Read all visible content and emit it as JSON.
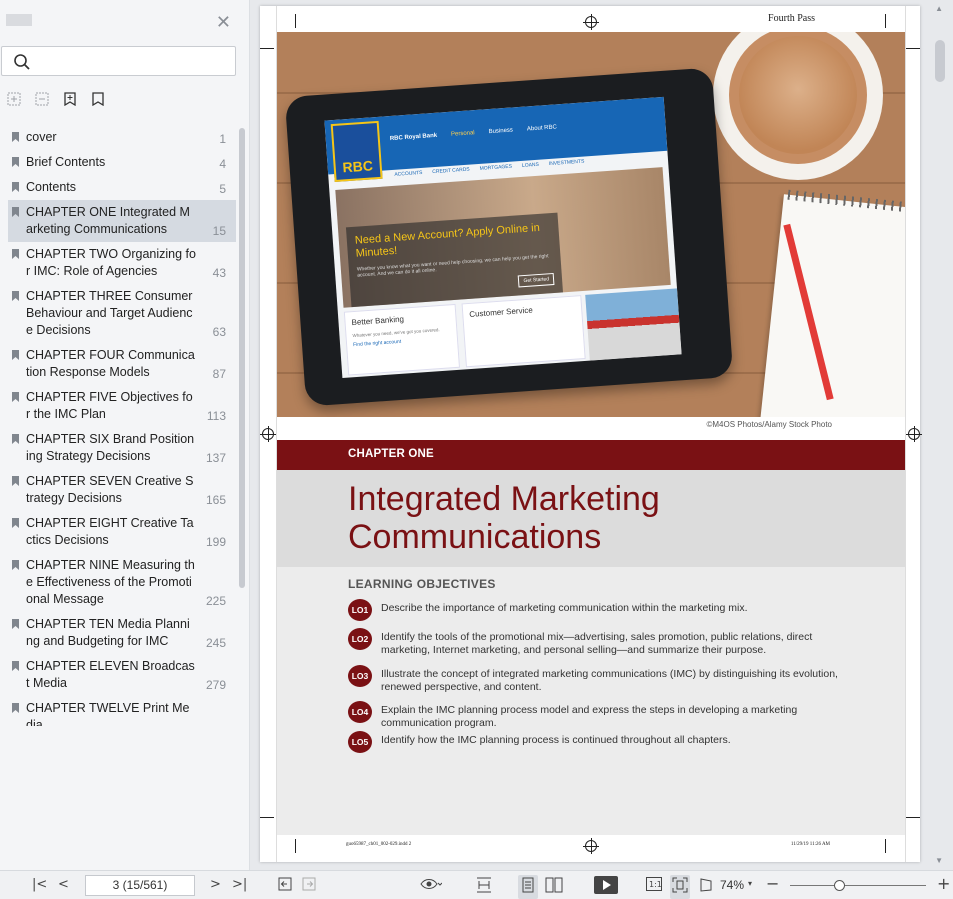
{
  "sidebar": {
    "search": {
      "value": "",
      "placeholder": ""
    },
    "toc": [
      {
        "label": "cover",
        "page": "1"
      },
      {
        "label": "Brief Contents",
        "page": "4"
      },
      {
        "label": "Contents",
        "page": "5"
      },
      {
        "label": "CHAPTER ONE Integrated Marketing  Communications",
        "page": "15",
        "selected": true
      },
      {
        "label": "CHAPTER TWO Organizing for IMC:  Role of Agencies",
        "page": "43"
      },
      {
        "label": "CHAPTER THREE  Consumer Behaviour and  Target Audience Decisions",
        "page": "63"
      },
      {
        "label": "CHAPTER FOUR Communication  Response Models",
        "page": "87"
      },
      {
        "label": "CHAPTER FIVE Objectives for the  IMC Plan",
        "page": "113"
      },
      {
        "label": "CHAPTER SIX Brand Positioning  Strategy Decisions",
        "page": "137"
      },
      {
        "label": "CHAPTER SEVEN Creative Strategy  Decisions",
        "page": "165"
      },
      {
        "label": "CHAPTER EIGHT Creative Tactics Decisions",
        "page": "199"
      },
      {
        "label": "CHAPTER NINE Measuring the Effectiveness  of the Promotional Message",
        "page": "225"
      },
      {
        "label": "CHAPTER TEN Media Planning and  Budgeting for IMC",
        "page": "245"
      },
      {
        "label": "CHAPTER ELEVEN Broadcast Media",
        "page": "279"
      },
      {
        "label": "CHAPTER TWELVE Print Media",
        "page": ""
      }
    ]
  },
  "page": {
    "pass_label": "Fourth Pass",
    "photo_credit": "©M4OS Photos/Alamy Stock Photo",
    "tablet": {
      "bank_name": "RBC Royal Bank",
      "logo": "RBC",
      "nav": [
        "Personal",
        "Business",
        "About RBC"
      ],
      "subnav": [
        "ACCOUNTS",
        "CREDIT CARDS",
        "MORTGAGES",
        "LOANS",
        "INVESTMENTS"
      ],
      "hero_heading": "Need a New Account? Apply Online in Minutes!",
      "hero_text": "Whether you know what you want or need help choosing, we can help you get the right account. And we can do it all online.",
      "hero_button": "Get Started",
      "card1_heading": "Better Banking",
      "card1_text": "Whatever you need, we've got you covered.",
      "card1_link": "Find the right account",
      "card2_heading": "Customer Service"
    },
    "chapter_label": "CHAPTER ONE",
    "title_line1": "Integrated Marketing",
    "title_line2": "Communications",
    "lo_heading": "LEARNING OBJECTIVES",
    "objectives": [
      {
        "id": "LO1",
        "text": "Describe the importance of marketing communication within the marketing mix."
      },
      {
        "id": "LO2",
        "text": "Identify the tools of the promotional mix—advertising, sales promotion, public relations, direct marketing, Internet marketing, and personal selling—and summarize their purpose."
      },
      {
        "id": "LO3",
        "text": "Illustrate the concept of integrated marketing communications (IMC) by distinguishing its evolution, renewed perspective, and content."
      },
      {
        "id": "LO4",
        "text": "Explain the IMC planning process model and express the steps in developing a marketing communication program."
      },
      {
        "id": "LO5",
        "text": "Identify how the IMC planning process is continued throughout all chapters."
      }
    ],
    "slug_left": "guo65987_ch01_002-029.indd   2",
    "slug_right": "11/29/19  11:26 AM"
  },
  "toolbar": {
    "page_indicator": "3 (15/561)",
    "zoom": "74%"
  },
  "colors": {
    "accent": "#7a1114",
    "rbc_blue": "#1766b5",
    "rbc_gold": "#f5c518"
  }
}
